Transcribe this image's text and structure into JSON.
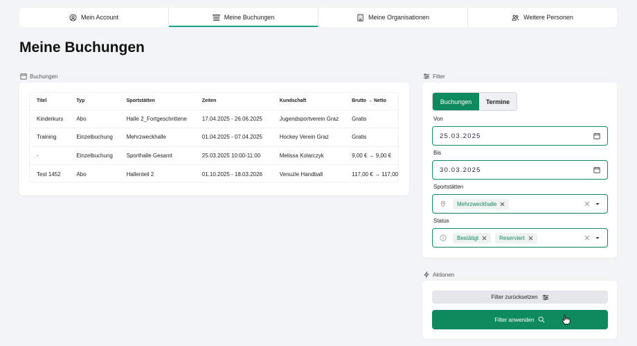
{
  "tabs": [
    {
      "label": "Mein Account",
      "icon": "user-circle-icon"
    },
    {
      "label": "Meine Buchungen",
      "icon": "list-icon"
    },
    {
      "label": "Meine Organisationen",
      "icon": "building-icon"
    },
    {
      "label": "Weitere Personen",
      "icon": "people-icon"
    }
  ],
  "page_title": "Meine Buchungen",
  "bookings": {
    "label": "Buchungen",
    "columns": [
      "Titel",
      "Typ",
      "Sportstätten",
      "Zeiten",
      "Kundschaft",
      "Brutto → Netto"
    ],
    "rows": [
      [
        "Kinderkurs",
        "Abo",
        "Halle 2_Fortgeschrittene",
        "17.04.2025 - 26.06.2025",
        "Jugendsportverein Graz",
        "Gratis"
      ],
      [
        "Training",
        "Einzelbuchung",
        "Mehrzweckhalle",
        "01.04.2025 - 07.04.2025",
        "Hockey Verein Graz",
        "Gratis"
      ],
      [
        "-",
        "Einzelbuchung",
        "Sporthalle Gesamt",
        "25.03.2025 10:00-11:00",
        "Melissa Kolarczyk",
        "9,00 € → 9,00 €"
      ],
      [
        "Test 1452",
        "Abo",
        "Hallenteil 2",
        "01.10.2025 - 18.03.2026",
        "Venuzle Handball",
        "117,00 € → 117,00"
      ]
    ]
  },
  "filter": {
    "label": "Filter",
    "segment": {
      "buchungen": "Buchungen",
      "termine": "Termine"
    },
    "von_label": "Von",
    "von_value": "25.03.2025",
    "bis_label": "Bis",
    "bis_value": "30.03.2025",
    "sportstaetten_label": "Sportstätten",
    "sportstaetten_chips": [
      "Mehrzweckhalle"
    ],
    "status_label": "Status",
    "status_chips": [
      "Bestätigt",
      "Reserviert"
    ]
  },
  "actions": {
    "label": "Aktionen",
    "reset": "Filter zurücksetzen",
    "apply": "Filter anwenden"
  },
  "colors": {
    "accent": "#0f8a5f",
    "tab_underline": "#16a085"
  }
}
